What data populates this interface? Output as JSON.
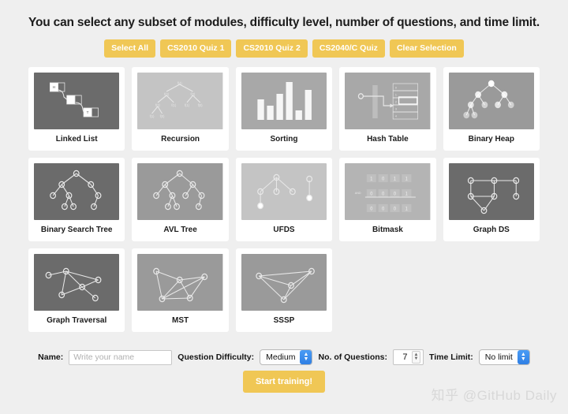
{
  "header": {
    "title": "You can select any subset of modules, difficulty level, number of questions, and time limit.",
    "quiz_buttons": [
      {
        "label": "Select All",
        "name": "select-all-button"
      },
      {
        "label": "CS2010 Quiz 1",
        "name": "cs2010-quiz-1-button"
      },
      {
        "label": "CS2010 Quiz 2",
        "name": "cs2010-quiz-2-button"
      },
      {
        "label": "CS2040/C Quiz",
        "name": "cs2040c-quiz-button"
      },
      {
        "label": "Clear Selection",
        "name": "clear-selection-button"
      }
    ]
  },
  "modules": [
    {
      "label": "Linked List",
      "thumb": "linked-list",
      "bg": "#6b6b6b"
    },
    {
      "label": "Recursion",
      "thumb": "recursion-tree",
      "bg": "#c4c4c4"
    },
    {
      "label": "Sorting",
      "thumb": "sorting-bars",
      "bg": "#a8a8a8"
    },
    {
      "label": "Hash Table",
      "thumb": "hash-table",
      "bg": "#a8a8a8"
    },
    {
      "label": "Binary Heap",
      "thumb": "binary-heap",
      "bg": "#9a9a9a"
    },
    {
      "label": "Binary Search Tree",
      "thumb": "binary-search-tree",
      "bg": "#6b6b6b"
    },
    {
      "label": "AVL Tree",
      "thumb": "avl-tree",
      "bg": "#9a9a9a"
    },
    {
      "label": "UFDS",
      "thumb": "ufds",
      "bg": "#c4c4c4"
    },
    {
      "label": "Bitmask",
      "thumb": "bitmask",
      "bg": "#b4b4b4"
    },
    {
      "label": "Graph DS",
      "thumb": "graph-ds",
      "bg": "#6b6b6b"
    },
    {
      "label": "Graph Traversal",
      "thumb": "graph-traversal",
      "bg": "#6b6b6b"
    },
    {
      "label": "MST",
      "thumb": "mst",
      "bg": "#9a9a9a"
    },
    {
      "label": "SSSP",
      "thumb": "sssp",
      "bg": "#9a9a9a"
    }
  ],
  "form": {
    "name_label": "Name:",
    "name_placeholder": "Write your name",
    "name_value": "",
    "difficulty_label": "Question Difficulty:",
    "difficulty_value": "Medium",
    "questions_label": "No. of Questions:",
    "questions_value": "7",
    "time_limit_label": "Time Limit:",
    "time_limit_value": "No limit",
    "start_label": "Start training!"
  },
  "watermark": "知乎 @GitHub Daily",
  "colors": {
    "accent": "#f0c755",
    "page_bg": "#efefef",
    "card_bg": "#ffffff"
  },
  "thumb_art": {
    "recursion_labels": [
      "f(4)",
      "f(3)",
      "f(2)",
      "f(2)",
      "f(1)",
      "f(1)",
      "f(0)",
      "f(1)",
      "f(0)"
    ],
    "sorting_bar_heights": [
      26,
      18,
      33,
      48,
      12,
      38
    ],
    "hash_slot_labels": [
      "0",
      "1",
      "2",
      "3",
      "4"
    ],
    "bitmask_rows": [
      {
        "op": "",
        "bits": [
          "1",
          "0",
          "1",
          "1"
        ]
      },
      {
        "op": "AND",
        "bits": [
          "0",
          "0",
          "0",
          "1"
        ]
      },
      {
        "op": "",
        "bits": [
          "0",
          "0",
          "0",
          "1"
        ]
      }
    ]
  }
}
